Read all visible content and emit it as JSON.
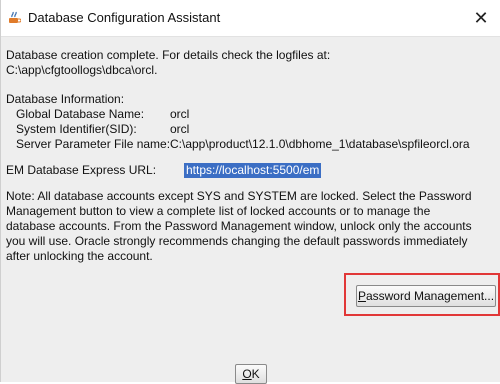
{
  "window": {
    "title": "Database Configuration Assistant",
    "close_glyph": "✕"
  },
  "messages": {
    "line1": "Database creation complete. For details check the logfiles at:",
    "line2": " C:\\app\\cfgtoollogs\\dbca\\orcl."
  },
  "db_info": {
    "heading": "Database Information:",
    "rows": [
      {
        "label": "Global Database Name:",
        "value": "orcl"
      },
      {
        "label": "System Identifier(SID):",
        "value": "orcl"
      },
      {
        "label": "Server Parameter File name:",
        "value": "C:\\app\\product\\12.1.0\\dbhome_1\\database\\spfileorcl.ora"
      }
    ]
  },
  "em": {
    "label": "EM Database Express URL:",
    "url": "https://localhost:5500/em"
  },
  "note": {
    "lines": [
      "Note: All database accounts except SYS and SYSTEM are locked. Select the Password",
      "Management button to view a complete list of locked accounts or to manage the",
      "database accounts. From the Password Management window, unlock only the accounts",
      "you will use. Oracle strongly recommends changing the default passwords immediately",
      "after unlocking the account."
    ]
  },
  "buttons": {
    "password_mnemonic": "P",
    "password_rest": "assword Management...",
    "ok_mnemonic": "O",
    "ok_rest": "K"
  },
  "colors": {
    "highlight_border": "#e13737",
    "selection": "#3b6ec4"
  }
}
